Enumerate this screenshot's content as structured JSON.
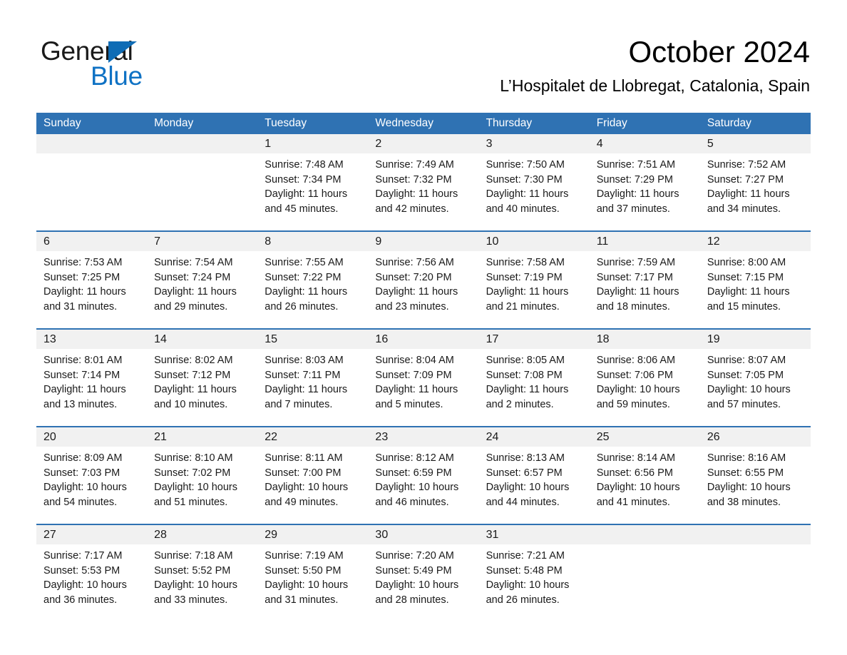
{
  "brand": {
    "name_part1": "General",
    "name_part2": "Blue",
    "flag_icon": "triangle-flag-icon",
    "accent_color": "#0f72c4"
  },
  "header": {
    "month_title": "October 2024",
    "location": "L’Hospitalet de Llobregat, Catalonia, Spain"
  },
  "calendar": {
    "header_bg": "#2f72b3",
    "daynum_bg": "#f1f1f1",
    "weekdays": [
      "Sunday",
      "Monday",
      "Tuesday",
      "Wednesday",
      "Thursday",
      "Friday",
      "Saturday"
    ],
    "weeks": [
      [
        {
          "day": "",
          "lines": []
        },
        {
          "day": "",
          "lines": []
        },
        {
          "day": "1",
          "lines": [
            "Sunrise: 7:48 AM",
            "Sunset: 7:34 PM",
            "Daylight: 11 hours",
            "and 45 minutes."
          ]
        },
        {
          "day": "2",
          "lines": [
            "Sunrise: 7:49 AM",
            "Sunset: 7:32 PM",
            "Daylight: 11 hours",
            "and 42 minutes."
          ]
        },
        {
          "day": "3",
          "lines": [
            "Sunrise: 7:50 AM",
            "Sunset: 7:30 PM",
            "Daylight: 11 hours",
            "and 40 minutes."
          ]
        },
        {
          "day": "4",
          "lines": [
            "Sunrise: 7:51 AM",
            "Sunset: 7:29 PM",
            "Daylight: 11 hours",
            "and 37 minutes."
          ]
        },
        {
          "day": "5",
          "lines": [
            "Sunrise: 7:52 AM",
            "Sunset: 7:27 PM",
            "Daylight: 11 hours",
            "and 34 minutes."
          ]
        }
      ],
      [
        {
          "day": "6",
          "lines": [
            "Sunrise: 7:53 AM",
            "Sunset: 7:25 PM",
            "Daylight: 11 hours",
            "and 31 minutes."
          ]
        },
        {
          "day": "7",
          "lines": [
            "Sunrise: 7:54 AM",
            "Sunset: 7:24 PM",
            "Daylight: 11 hours",
            "and 29 minutes."
          ]
        },
        {
          "day": "8",
          "lines": [
            "Sunrise: 7:55 AM",
            "Sunset: 7:22 PM",
            "Daylight: 11 hours",
            "and 26 minutes."
          ]
        },
        {
          "day": "9",
          "lines": [
            "Sunrise: 7:56 AM",
            "Sunset: 7:20 PM",
            "Daylight: 11 hours",
            "and 23 minutes."
          ]
        },
        {
          "day": "10",
          "lines": [
            "Sunrise: 7:58 AM",
            "Sunset: 7:19 PM",
            "Daylight: 11 hours",
            "and 21 minutes."
          ]
        },
        {
          "day": "11",
          "lines": [
            "Sunrise: 7:59 AM",
            "Sunset: 7:17 PM",
            "Daylight: 11 hours",
            "and 18 minutes."
          ]
        },
        {
          "day": "12",
          "lines": [
            "Sunrise: 8:00 AM",
            "Sunset: 7:15 PM",
            "Daylight: 11 hours",
            "and 15 minutes."
          ]
        }
      ],
      [
        {
          "day": "13",
          "lines": [
            "Sunrise: 8:01 AM",
            "Sunset: 7:14 PM",
            "Daylight: 11 hours",
            "and 13 minutes."
          ]
        },
        {
          "day": "14",
          "lines": [
            "Sunrise: 8:02 AM",
            "Sunset: 7:12 PM",
            "Daylight: 11 hours",
            "and 10 minutes."
          ]
        },
        {
          "day": "15",
          "lines": [
            "Sunrise: 8:03 AM",
            "Sunset: 7:11 PM",
            "Daylight: 11 hours",
            "and 7 minutes."
          ]
        },
        {
          "day": "16",
          "lines": [
            "Sunrise: 8:04 AM",
            "Sunset: 7:09 PM",
            "Daylight: 11 hours",
            "and 5 minutes."
          ]
        },
        {
          "day": "17",
          "lines": [
            "Sunrise: 8:05 AM",
            "Sunset: 7:08 PM",
            "Daylight: 11 hours",
            "and 2 minutes."
          ]
        },
        {
          "day": "18",
          "lines": [
            "Sunrise: 8:06 AM",
            "Sunset: 7:06 PM",
            "Daylight: 10 hours",
            "and 59 minutes."
          ]
        },
        {
          "day": "19",
          "lines": [
            "Sunrise: 8:07 AM",
            "Sunset: 7:05 PM",
            "Daylight: 10 hours",
            "and 57 minutes."
          ]
        }
      ],
      [
        {
          "day": "20",
          "lines": [
            "Sunrise: 8:09 AM",
            "Sunset: 7:03 PM",
            "Daylight: 10 hours",
            "and 54 minutes."
          ]
        },
        {
          "day": "21",
          "lines": [
            "Sunrise: 8:10 AM",
            "Sunset: 7:02 PM",
            "Daylight: 10 hours",
            "and 51 minutes."
          ]
        },
        {
          "day": "22",
          "lines": [
            "Sunrise: 8:11 AM",
            "Sunset: 7:00 PM",
            "Daylight: 10 hours",
            "and 49 minutes."
          ]
        },
        {
          "day": "23",
          "lines": [
            "Sunrise: 8:12 AM",
            "Sunset: 6:59 PM",
            "Daylight: 10 hours",
            "and 46 minutes."
          ]
        },
        {
          "day": "24",
          "lines": [
            "Sunrise: 8:13 AM",
            "Sunset: 6:57 PM",
            "Daylight: 10 hours",
            "and 44 minutes."
          ]
        },
        {
          "day": "25",
          "lines": [
            "Sunrise: 8:14 AM",
            "Sunset: 6:56 PM",
            "Daylight: 10 hours",
            "and 41 minutes."
          ]
        },
        {
          "day": "26",
          "lines": [
            "Sunrise: 8:16 AM",
            "Sunset: 6:55 PM",
            "Daylight: 10 hours",
            "and 38 minutes."
          ]
        }
      ],
      [
        {
          "day": "27",
          "lines": [
            "Sunrise: 7:17 AM",
            "Sunset: 5:53 PM",
            "Daylight: 10 hours",
            "and 36 minutes."
          ]
        },
        {
          "day": "28",
          "lines": [
            "Sunrise: 7:18 AM",
            "Sunset: 5:52 PM",
            "Daylight: 10 hours",
            "and 33 minutes."
          ]
        },
        {
          "day": "29",
          "lines": [
            "Sunrise: 7:19 AM",
            "Sunset: 5:50 PM",
            "Daylight: 10 hours",
            "and 31 minutes."
          ]
        },
        {
          "day": "30",
          "lines": [
            "Sunrise: 7:20 AM",
            "Sunset: 5:49 PM",
            "Daylight: 10 hours",
            "and 28 minutes."
          ]
        },
        {
          "day": "31",
          "lines": [
            "Sunrise: 7:21 AM",
            "Sunset: 5:48 PM",
            "Daylight: 10 hours",
            "and 26 minutes."
          ]
        },
        {
          "day": "",
          "lines": []
        },
        {
          "day": "",
          "lines": []
        }
      ]
    ]
  }
}
